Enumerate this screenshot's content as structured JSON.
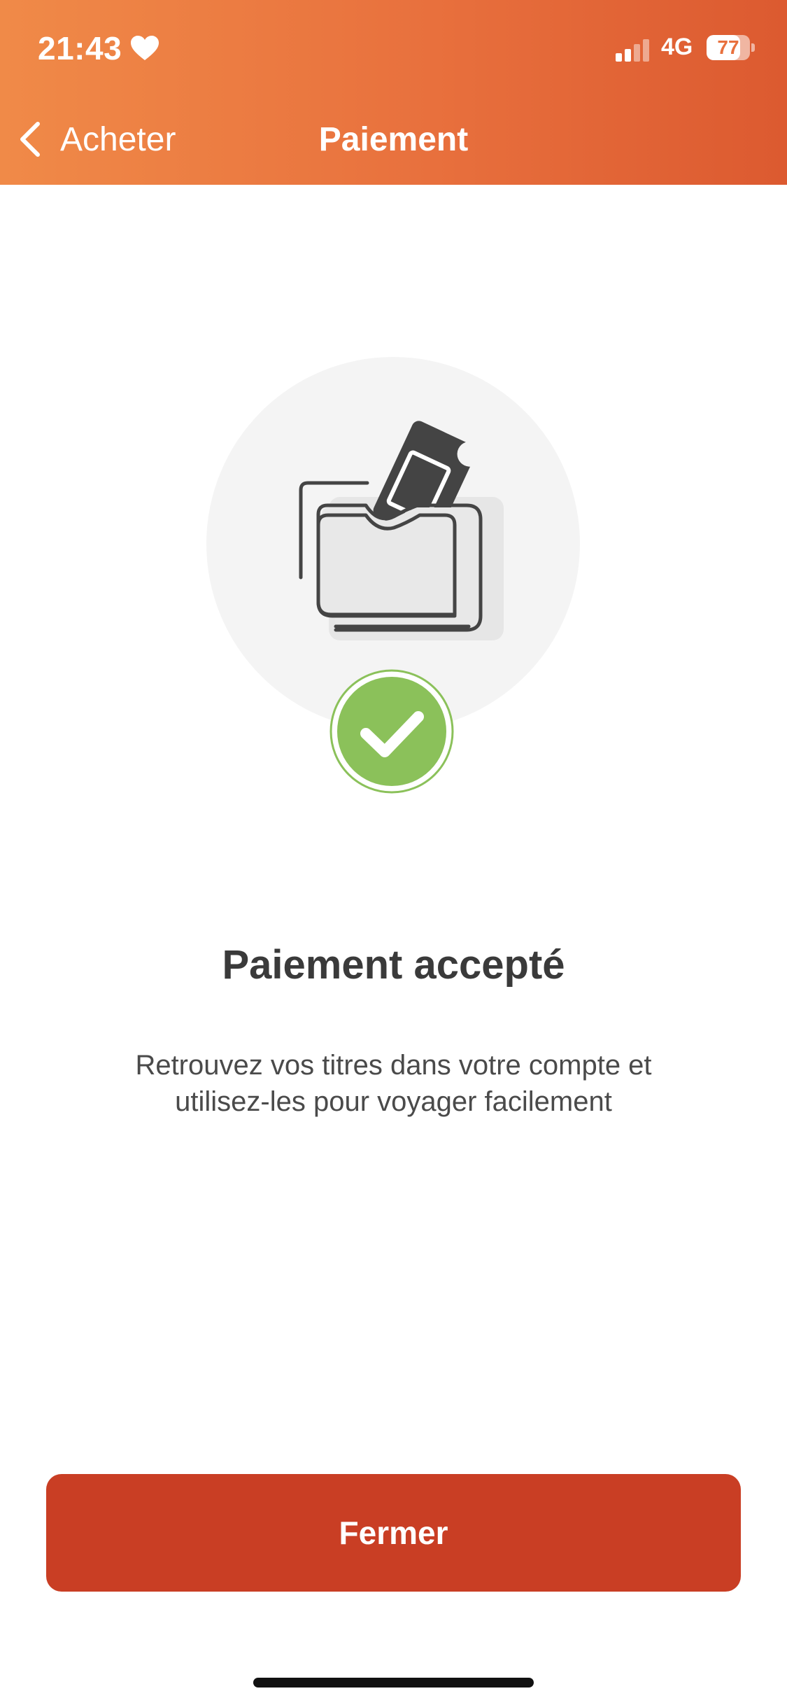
{
  "status_bar": {
    "time": "21:43",
    "network": "4G",
    "battery_level": "77",
    "battery_fraction": 0.77,
    "icons": [
      "heart-icon",
      "signal-icon",
      "battery-icon"
    ]
  },
  "nav": {
    "back_label": "Acheter",
    "title": "Paiement"
  },
  "result": {
    "title": "Paiement accepté",
    "message": "Retrouvez vos titres dans votre compte et utilisez-les pour voyager facilement",
    "icons": [
      "ticket-wallet-icon",
      "success-check-icon"
    ]
  },
  "actions": {
    "close_label": "Fermer"
  },
  "colors": {
    "header_start": "#f08a48",
    "header_end": "#dc5a30",
    "primary_button": "#c93e24",
    "success": "#8bc15a"
  }
}
